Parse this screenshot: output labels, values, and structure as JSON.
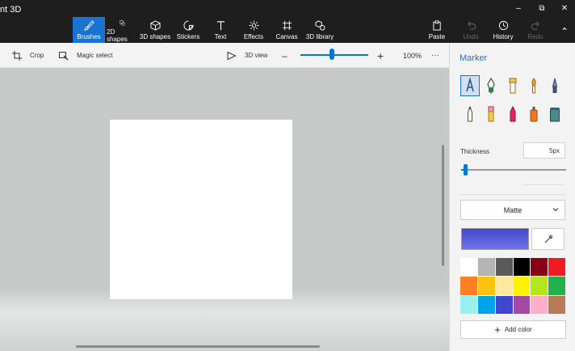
{
  "app": {
    "title": "nt 3D"
  },
  "ribbon": {
    "tools": [
      {
        "label": "Brushes",
        "icon": "brush-icon"
      },
      {
        "label": "2D shapes",
        "icon": "2d-shapes-icon"
      },
      {
        "label": "3D shapes",
        "icon": "3d-shapes-icon"
      },
      {
        "label": "Stickers",
        "icon": "stickers-icon"
      },
      {
        "label": "Text",
        "icon": "text-icon"
      },
      {
        "label": "Effects",
        "icon": "effects-icon"
      },
      {
        "label": "Canvas",
        "icon": "canvas-icon"
      },
      {
        "label": "3D library",
        "icon": "3d-library-icon"
      }
    ],
    "right": [
      {
        "label": "Paste",
        "icon": "paste-icon"
      },
      {
        "label": "Undo",
        "icon": "undo-icon"
      },
      {
        "label": "History",
        "icon": "history-icon"
      },
      {
        "label": "Redo",
        "icon": "redo-icon"
      }
    ],
    "window": {
      "minimize": "–",
      "restore": "⧉",
      "close": "✕",
      "collapse": "⌃"
    }
  },
  "toolbar": {
    "crop": "Crop",
    "magic_select": "Magic select",
    "view3d": "3D view",
    "zoom_minus": "–",
    "zoom_plus": "+",
    "zoom": "100%",
    "more": "···",
    "zoom_level": 0.46
  },
  "panel": {
    "title": "Marker",
    "brushes": [
      {
        "name": "marker",
        "selected": true
      },
      {
        "name": "calligraphy-pen"
      },
      {
        "name": "oil-brush"
      },
      {
        "name": "watercolor"
      },
      {
        "name": "pixel-pen"
      },
      {
        "name": "pencil"
      },
      {
        "name": "eraser"
      },
      {
        "name": "crayon"
      },
      {
        "name": "spray-can"
      },
      {
        "name": "fill"
      }
    ],
    "thickness_label": "Thickness",
    "thickness_value": "5px",
    "finish": "Matte",
    "current_color": "#4447cc",
    "palette": [
      "#ffffff",
      "#b4b4b4",
      "#5a5a5a",
      "#000000",
      "#880015",
      "#ed1c24",
      "#ff7f27",
      "#ffc20e",
      "#ffe8a0",
      "#fff200",
      "#b5e61d",
      "#22b14c",
      "#99f0f0",
      "#00a2e8",
      "#3f48cc",
      "#a349a4",
      "#ffaec9",
      "#b97a57"
    ],
    "add_color": "Add color"
  }
}
